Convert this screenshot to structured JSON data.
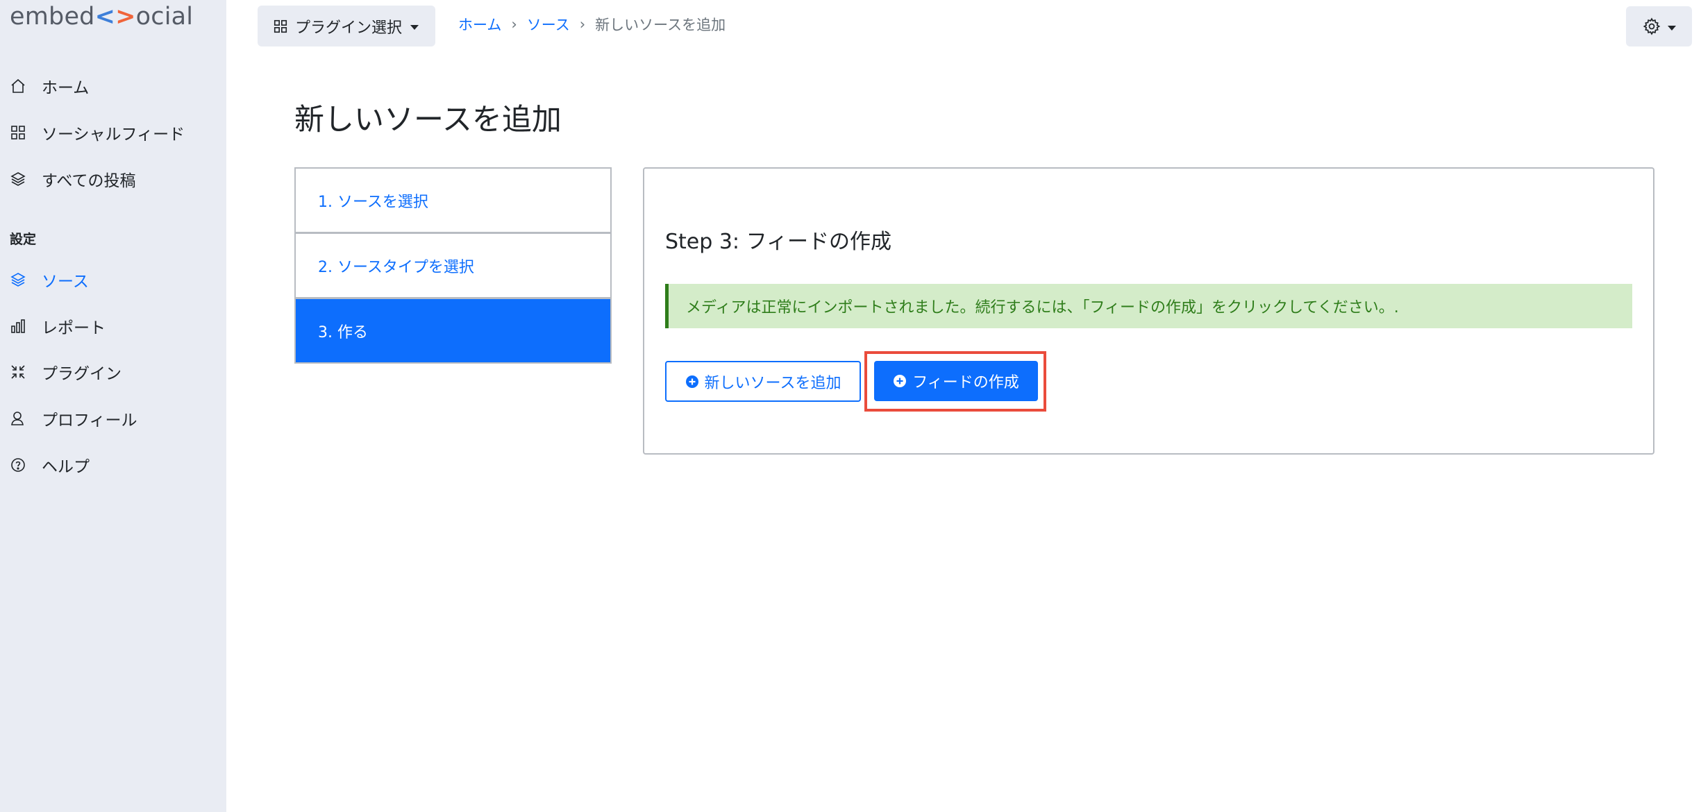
{
  "sidebar": {
    "logo": {
      "part1": "embed",
      "lt": "<",
      "gt": ">",
      "part2": "ocial"
    },
    "items": [
      {
        "label": "ホーム",
        "icon": "home-icon"
      },
      {
        "label": "ソーシャルフィード",
        "icon": "grid-icon"
      },
      {
        "label": "すべての投稿",
        "icon": "layers-icon"
      }
    ],
    "settings_heading": "設定",
    "settings_items": [
      {
        "label": "ソース",
        "icon": "layers-icon",
        "active": true
      },
      {
        "label": "レポート",
        "icon": "bar-chart-icon"
      },
      {
        "label": "プラグイン",
        "icon": "compress-icon"
      },
      {
        "label": "プロフィール",
        "icon": "user-icon"
      },
      {
        "label": "ヘルプ",
        "icon": "help-icon"
      }
    ]
  },
  "topbar": {
    "plugin_select_label": "プラグイン選択",
    "breadcrumb": {
      "home": "ホーム",
      "sources": "ソース",
      "current": "新しいソースを追加",
      "sep": "›"
    }
  },
  "page": {
    "title": "新しいソースを追加",
    "steps": [
      {
        "label": "1. ソースを選択"
      },
      {
        "label": "2. ソースタイプを選択"
      },
      {
        "label": "3. 作る",
        "active": true
      }
    ],
    "card": {
      "title": "Step 3: フィードの作成",
      "alert": "メディアは正常にインポートされました。続行するには、「フィードの作成」をクリックしてください。.",
      "add_source_button": "新しいソースを追加",
      "create_feed_button": "フィードの作成"
    }
  },
  "colors": {
    "primary": "#0d6efd",
    "sidebar_bg": "#e9ecf3",
    "alert_bg": "#d4ecc9",
    "alert_text": "#2e7d1a",
    "highlight": "#ea4c3c"
  }
}
